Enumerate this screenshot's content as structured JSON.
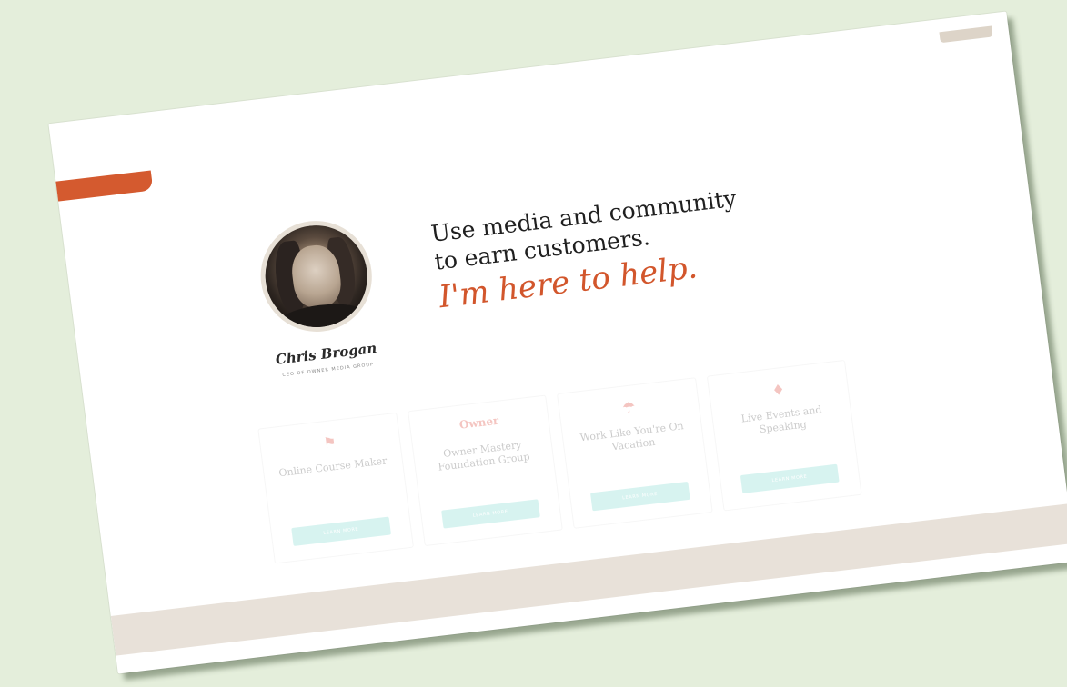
{
  "profile": {
    "name": "Chris Brogan",
    "subtitle": "CEO of Owner Media Group"
  },
  "hero": {
    "headline_line1": "Use media and community",
    "headline_line2": "to earn customers.",
    "tagline": "I'm here to help."
  },
  "cards": [
    {
      "icon": "flag-icon",
      "glyph": "⚑",
      "title": "Online Course Maker",
      "button": "Learn More"
    },
    {
      "icon": "owner-logo-icon",
      "glyph": "Owner",
      "title": "Owner Mastery Foundation Group",
      "button": "Learn More"
    },
    {
      "icon": "beach-umbrella-icon",
      "glyph": "☂",
      "title": "Work Like You're On Vacation",
      "button": "Learn More"
    },
    {
      "icon": "microphone-icon",
      "glyph": "♦",
      "title": "Live Events and Speaking",
      "button": "Learn More"
    }
  ],
  "colors": {
    "accent": "#d2562c",
    "button": "#8fdfd6",
    "background": "#e4eedb"
  }
}
